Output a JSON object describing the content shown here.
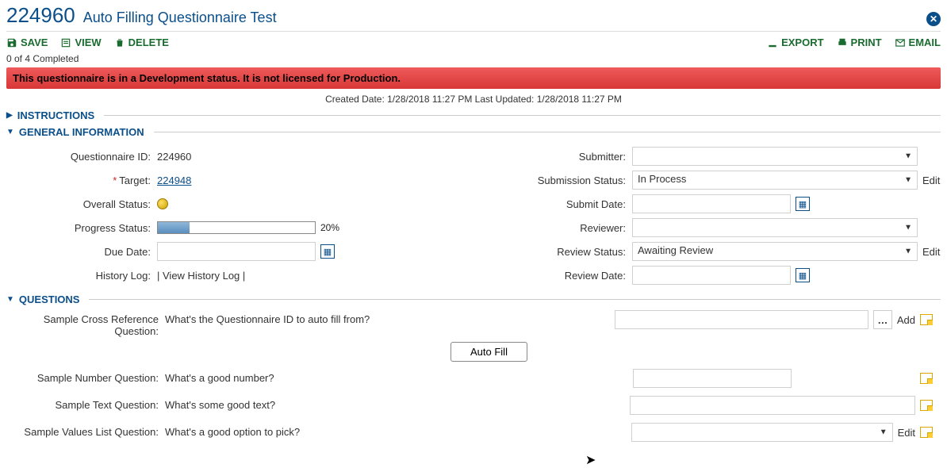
{
  "header": {
    "id": "224960",
    "title": "Auto Filling Questionnaire Test"
  },
  "toolbar": {
    "save": "SAVE",
    "view": "VIEW",
    "delete": "DELETE",
    "export": "EXPORT",
    "print": "PRINT",
    "email": "EMAIL"
  },
  "completion": "0 of 4 Completed",
  "warning": "This questionnaire is in a Development status. It is not licensed for Production.",
  "meta": "Created Date: 1/28/2018 11:27 PM Last Updated: 1/28/2018 11:27 PM",
  "sections": {
    "instructions": "INSTRUCTIONS",
    "general": "GENERAL INFORMATION",
    "questions": "QUESTIONS"
  },
  "general": {
    "labels": {
      "qid": "Questionnaire ID:",
      "target": "Target:",
      "overall": "Overall Status:",
      "progress": "Progress Status:",
      "due": "Due Date:",
      "history": "History Log:",
      "submitter": "Submitter:",
      "subStatus": "Submission Status:",
      "subDate": "Submit Date:",
      "reviewer": "Reviewer:",
      "revStatus": "Review Status:",
      "revDate": "Review Date:"
    },
    "values": {
      "qid": "224960",
      "target": "224948",
      "progressPct": "20%",
      "progressWidth": 20,
      "historyLink": "| View History Log |",
      "subStatus": "In Process",
      "revStatus": "Awaiting Review",
      "edit": "Edit"
    }
  },
  "questions": [
    {
      "label": "Sample Cross Reference Question:",
      "text": "What's the Questionnaire ID to auto fill from?",
      "type": "crossref",
      "add": "Add"
    },
    {
      "label": "",
      "text": "",
      "type": "autofill",
      "button": "Auto Fill"
    },
    {
      "label": "Sample Number Question:",
      "text": "What's a good number?",
      "type": "number"
    },
    {
      "label": "Sample Text Question:",
      "text": "What's some good text?",
      "type": "text"
    },
    {
      "label": "Sample Values List Question:",
      "text": "What's a good option to pick?",
      "type": "select",
      "edit": "Edit"
    }
  ]
}
